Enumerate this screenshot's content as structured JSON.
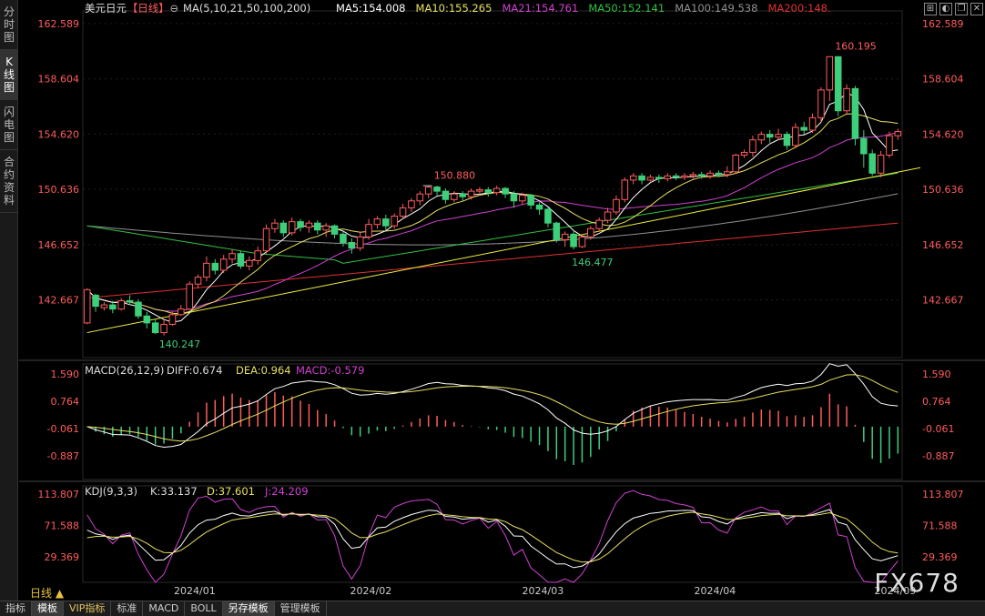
{
  "sidebar": {
    "tabs": [
      {
        "label": "分时图",
        "active": false
      },
      {
        "label": "K线图",
        "active": true
      },
      {
        "label": "闪电图",
        "active": false
      },
      {
        "label": "合约资料",
        "active": false
      }
    ]
  },
  "header": {
    "symbol": "美元日元",
    "period": "【日线】",
    "ma_label": "MA(5,10,21,50,100,200)",
    "ma5": "MA5:154.008",
    "ma10": "MA10:155.265",
    "ma21": "MA21:154.761",
    "ma50": "MA50:152.141",
    "ma100": "MA100:149.538",
    "ma200": "MA200:148."
  },
  "macd_header": {
    "label": "MACD(26,12,9)",
    "diff": "DIFF:0.674",
    "dea": "DEA:0.964",
    "macd": "MACD:-0.579"
  },
  "kdj_header": {
    "label": "KDJ(9,3,3)",
    "k": "K:33.137",
    "d": "D:37.601",
    "j": "J:24.209"
  },
  "colors": {
    "up": "#ff5c5c",
    "down": "#3ecf7a",
    "ma5": "#ffffff",
    "ma10": "#e8e060",
    "ma21": "#d040d0",
    "ma50": "#30c040",
    "ma100": "#909090",
    "ma200": "#e03030",
    "trend": "#f0f040"
  },
  "price_axis": [
    "162.589",
    "158.604",
    "154.620",
    "150.636",
    "146.652",
    "142.667"
  ],
  "macd_axis": [
    "1.590",
    "0.764",
    "-0.061",
    "-0.887"
  ],
  "kdj_axis": [
    "113.807",
    "71.588",
    "29.369"
  ],
  "x_axis": [
    "2024/01",
    "2024/02",
    "2024/03",
    "2024/04",
    "2024/09"
  ],
  "annotations": {
    "high": "160.195",
    "mid_high": "150.880",
    "mid_low": "146.477",
    "low": "140.247"
  },
  "bottom_period": "日线 ▲",
  "bottom_tabs": [
    {
      "label": "指标",
      "active": false,
      "vip": false
    },
    {
      "label": "模板",
      "active": true,
      "vip": false
    },
    {
      "label": "VIP指标",
      "active": false,
      "vip": true
    },
    {
      "label": "标准",
      "active": false,
      "vip": false
    },
    {
      "label": "MACD",
      "active": false,
      "vip": false
    },
    {
      "label": "BOLL",
      "active": false,
      "vip": false
    },
    {
      "label": "另存模板",
      "active": true,
      "vip": false
    },
    {
      "label": "管理模板",
      "active": false,
      "vip": false
    }
  ],
  "watermark": "FX678",
  "chart_data": {
    "type": "candlestick",
    "ylim": [
      138.5,
      163.5
    ],
    "candles": [
      [
        141.0,
        143.4,
        143.5,
        140.9
      ],
      [
        143.0,
        142.2,
        143.1,
        141.8
      ],
      [
        142.1,
        142.3,
        142.5,
        141.9
      ],
      [
        142.3,
        142.0,
        142.6,
        141.7
      ],
      [
        142.0,
        142.6,
        142.8,
        141.9
      ],
      [
        142.6,
        142.5,
        143.0,
        142.3
      ],
      [
        142.5,
        141.5,
        142.7,
        141.3
      ],
      [
        141.5,
        141.0,
        141.8,
        140.6
      ],
      [
        141.0,
        140.3,
        141.3,
        140.2
      ],
      [
        140.3,
        140.9,
        141.2,
        140.1
      ],
      [
        140.9,
        141.6,
        141.8,
        140.8
      ],
      [
        141.6,
        142.0,
        142.3,
        141.5
      ],
      [
        142.0,
        143.8,
        144.0,
        141.9
      ],
      [
        143.8,
        144.3,
        144.5,
        143.5
      ],
      [
        144.3,
        145.3,
        145.8,
        144.0
      ],
      [
        145.3,
        144.8,
        145.6,
        144.5
      ],
      [
        144.8,
        145.6,
        145.9,
        144.6
      ],
      [
        145.6,
        146.0,
        146.3,
        145.3
      ],
      [
        146.0,
        145.1,
        146.2,
        144.9
      ],
      [
        145.1,
        145.5,
        145.8,
        144.8
      ],
      [
        145.5,
        146.2,
        146.5,
        145.2
      ],
      [
        146.2,
        147.8,
        148.1,
        146.0
      ],
      [
        147.8,
        148.2,
        148.5,
        147.5
      ],
      [
        148.2,
        147.5,
        148.4,
        147.2
      ],
      [
        147.5,
        148.3,
        148.6,
        147.3
      ],
      [
        148.3,
        147.9,
        148.5,
        147.6
      ],
      [
        147.9,
        148.2,
        148.4,
        147.5
      ],
      [
        148.2,
        147.7,
        148.4,
        147.4
      ],
      [
        147.7,
        148.0,
        148.2,
        147.2
      ],
      [
        148.0,
        147.4,
        148.1,
        147.1
      ],
      [
        147.4,
        146.8,
        147.6,
        146.5
      ],
      [
        146.8,
        146.4,
        147.1,
        146.0
      ],
      [
        146.4,
        147.2,
        147.5,
        146.2
      ],
      [
        147.2,
        148.1,
        148.5,
        147.0
      ],
      [
        148.1,
        148.5,
        148.7,
        147.8
      ],
      [
        148.5,
        148.0,
        148.8,
        147.7
      ],
      [
        148.0,
        148.7,
        148.9,
        147.8
      ],
      [
        148.7,
        149.3,
        149.6,
        148.5
      ],
      [
        149.3,
        149.8,
        150.0,
        149.0
      ],
      [
        149.8,
        150.3,
        150.5,
        149.5
      ],
      [
        150.3,
        150.8,
        150.9,
        150.0
      ],
      [
        150.8,
        150.5,
        150.9,
        150.2
      ],
      [
        150.5,
        149.9,
        150.7,
        149.6
      ],
      [
        149.9,
        150.3,
        150.5,
        149.7
      ],
      [
        150.3,
        150.1,
        150.5,
        149.8
      ],
      [
        150.1,
        150.5,
        150.7,
        149.9
      ],
      [
        150.5,
        150.6,
        150.8,
        150.2
      ],
      [
        150.6,
        150.4,
        150.8,
        150.1
      ],
      [
        150.4,
        150.7,
        150.9,
        150.2
      ],
      [
        150.7,
        150.3,
        150.8,
        150.0
      ],
      [
        150.3,
        149.8,
        150.5,
        149.3
      ],
      [
        149.8,
        150.2,
        150.4,
        149.5
      ],
      [
        150.2,
        149.5,
        150.3,
        149.2
      ],
      [
        149.5,
        149.2,
        149.7,
        148.8
      ],
      [
        149.2,
        148.2,
        149.3,
        147.9
      ],
      [
        148.2,
        147.0,
        148.3,
        146.8
      ],
      [
        147.0,
        147.4,
        147.6,
        146.5
      ],
      [
        147.4,
        146.5,
        147.6,
        146.3
      ],
      [
        146.5,
        147.2,
        147.4,
        146.4
      ],
      [
        147.2,
        147.8,
        148.0,
        147.0
      ],
      [
        147.8,
        148.4,
        148.6,
        147.6
      ],
      [
        148.4,
        149.0,
        149.3,
        148.2
      ],
      [
        149.0,
        149.9,
        150.2,
        148.8
      ],
      [
        149.9,
        151.3,
        151.5,
        149.7
      ],
      [
        151.3,
        151.6,
        151.8,
        151.0
      ],
      [
        151.6,
        151.3,
        151.8,
        151.0
      ],
      [
        151.3,
        151.5,
        151.7,
        151.2
      ],
      [
        151.5,
        151.4,
        151.7,
        151.1
      ],
      [
        151.4,
        151.6,
        151.8,
        151.2
      ],
      [
        151.6,
        151.5,
        151.8,
        151.3
      ],
      [
        151.5,
        151.6,
        151.8,
        151.3
      ],
      [
        151.6,
        151.7,
        151.9,
        151.4
      ],
      [
        151.7,
        151.6,
        151.9,
        151.4
      ],
      [
        151.6,
        151.8,
        152.0,
        151.4
      ],
      [
        151.8,
        151.7,
        152.0,
        151.5
      ],
      [
        151.7,
        151.9,
        152.3,
        151.5
      ],
      [
        151.9,
        153.1,
        153.2,
        151.8
      ],
      [
        153.1,
        153.3,
        153.5,
        152.9
      ],
      [
        153.3,
        154.2,
        154.5,
        153.0
      ],
      [
        154.2,
        154.6,
        154.8,
        153.9
      ],
      [
        154.6,
        154.4,
        154.9,
        154.0
      ],
      [
        154.4,
        154.6,
        155.0,
        154.2
      ],
      [
        154.6,
        153.8,
        154.8,
        153.5
      ],
      [
        153.8,
        155.1,
        155.4,
        153.6
      ],
      [
        155.1,
        154.9,
        155.5,
        154.6
      ],
      [
        154.9,
        155.8,
        156.1,
        154.7
      ],
      [
        155.8,
        157.8,
        158.0,
        155.5
      ],
      [
        157.8,
        160.2,
        160.2,
        157.0
      ],
      [
        160.2,
        156.3,
        160.0,
        155.9
      ],
      [
        156.3,
        157.9,
        158.2,
        156.0
      ],
      [
        157.9,
        154.3,
        158.1,
        153.8
      ],
      [
        154.3,
        153.2,
        154.9,
        152.2
      ],
      [
        153.2,
        151.8,
        153.5,
        151.6
      ],
      [
        151.8,
        153.1,
        153.4,
        151.5
      ],
      [
        153.1,
        154.5,
        154.8,
        152.9
      ],
      [
        154.5,
        154.8,
        155.0,
        154.2
      ]
    ],
    "trendline": [
      [
        0,
        140.3
      ],
      [
        97,
        152.2
      ]
    ],
    "macd": {
      "diff": 0.674,
      "dea": 0.964,
      "macd": -0.579,
      "ylim": [
        -1.6,
        1.9
      ]
    },
    "kdj": {
      "k": 33.137,
      "d": 37.601,
      "j": 24.209,
      "ylim": [
        -5,
        125
      ]
    }
  }
}
